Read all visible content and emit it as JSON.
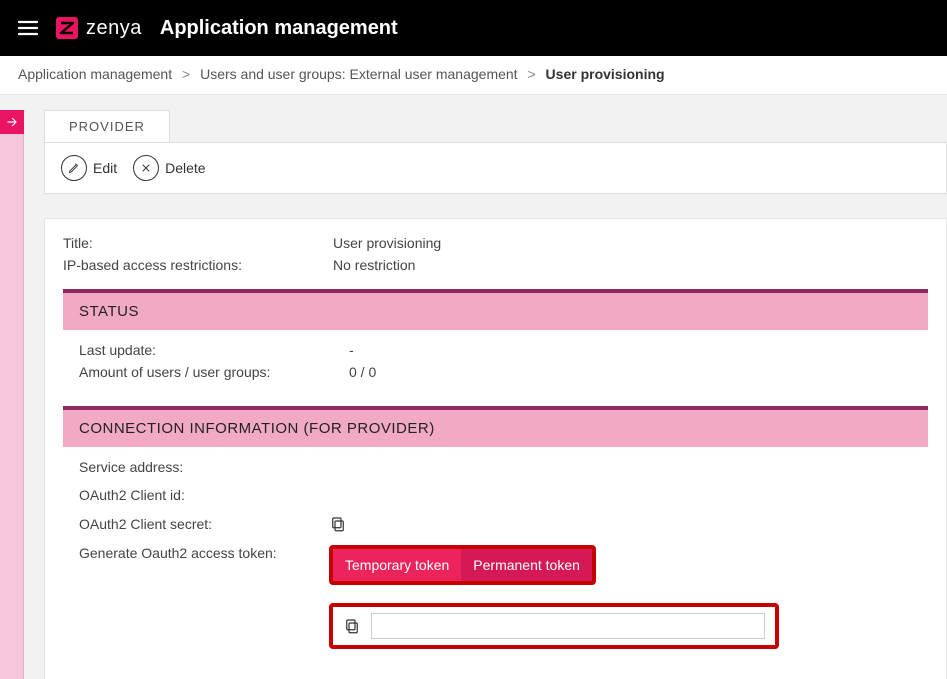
{
  "header": {
    "logo_text": "zenya",
    "app_title": "Application management"
  },
  "breadcrumb": {
    "items": [
      "Application management",
      "Users and user groups: External user management"
    ],
    "current": "User provisioning"
  },
  "tabs": {
    "provider": "PROVIDER"
  },
  "toolbar": {
    "edit": "Edit",
    "delete": "Delete"
  },
  "info": {
    "title_label": "Title:",
    "title_value": "User provisioning",
    "ip_label": "IP-based access restrictions:",
    "ip_value": "No restriction"
  },
  "status": {
    "heading": "STATUS",
    "last_update_label": "Last update:",
    "last_update_value": "-",
    "amount_label": "Amount of users / user groups:",
    "amount_value": "0 / 0"
  },
  "connection": {
    "heading": "CONNECTION INFORMATION (FOR PROVIDER)",
    "service_label": "Service address:",
    "service_value": "",
    "client_id_label": "OAuth2 Client id:",
    "client_id_value": "",
    "client_secret_label": "OAuth2 Client secret:",
    "client_secret_value": "",
    "generate_label": "Generate Oauth2 access token:",
    "temp_btn": "Temporary token",
    "perm_btn": "Permanent token",
    "token_value": ""
  }
}
